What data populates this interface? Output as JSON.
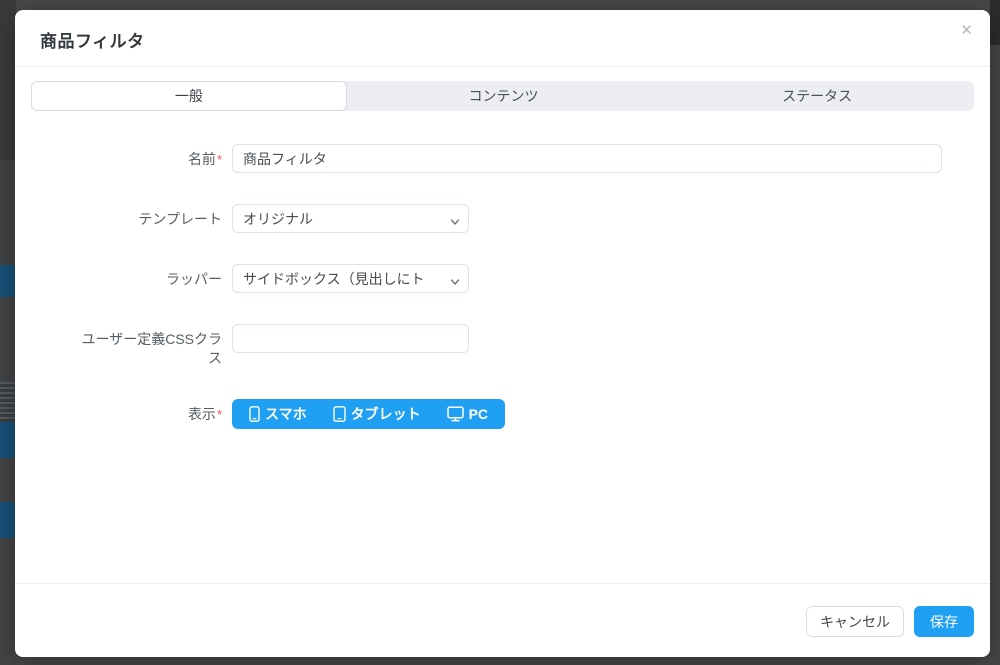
{
  "modal": {
    "title": "商品フィルタ",
    "close_glyph": "✕"
  },
  "tabs": [
    {
      "label": "一般",
      "active": true
    },
    {
      "label": "コンテンツ",
      "active": false
    },
    {
      "label": "ステータス",
      "active": false
    }
  ],
  "form": {
    "name": {
      "label": "名前",
      "required_mark": "*",
      "value": "商品フィルタ"
    },
    "template": {
      "label": "テンプレート",
      "value": "オリジナル"
    },
    "wrapper": {
      "label": "ラッパー",
      "value": "サイドボックス（見出しにト"
    },
    "css_class": {
      "label": "ユーザー定義CSSクラ\nス",
      "value": ""
    },
    "display": {
      "label": "表示",
      "required_mark": "*",
      "options": [
        {
          "label": "スマホ",
          "icon": "smartphone-icon",
          "active": true
        },
        {
          "label": "タブレット",
          "icon": "tablet-icon",
          "active": true
        },
        {
          "label": "PC",
          "icon": "desktop-icon",
          "active": true
        }
      ]
    }
  },
  "footer": {
    "cancel_label": "キャンセル",
    "save_label": "保存"
  },
  "colors": {
    "primary_blue": "#1fa0f2",
    "required_red": "#ef5562",
    "tabbar_bg": "#eceef1",
    "backdrop": "#46484a"
  }
}
